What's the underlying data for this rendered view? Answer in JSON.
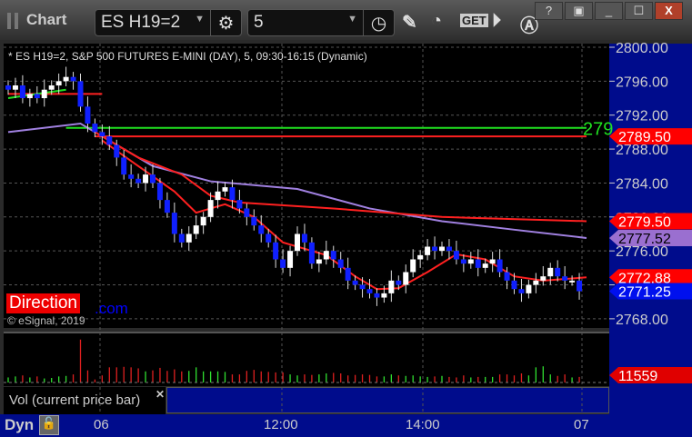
{
  "window": {
    "title": "Chart",
    "help": "?",
    "minimize": "_",
    "close": "X"
  },
  "toolbar": {
    "symbol": "ES H19=2",
    "interval": "5"
  },
  "header": "* ES H19=2, S&P 500 FUTURES E-MINI (DAY), 5, 09:30-16:15 (Dynamic)",
  "watermark": {
    "brand": "Direction",
    "suffix": ".com"
  },
  "copyright": "© eSignal, 2019",
  "price_axis": {
    "ticks": [
      "2800.00",
      "2796.00",
      "2792.00",
      "2788.00",
      "2784.00",
      "2780.00",
      "2776.00",
      "2772.00",
      "2768.00"
    ],
    "tick_values": [
      2800,
      2796,
      2792,
      2788,
      2784,
      2780,
      2776,
      2772,
      2768
    ]
  },
  "markers": [
    {
      "label": "2789.50",
      "value": 2789.5,
      "color": "#ff0000",
      "text": "#ffffff"
    },
    {
      "label": "2779.50",
      "value": 2779.5,
      "color": "#ff0000",
      "text": "#ffffff"
    },
    {
      "label": "2777.52",
      "value": 2777.52,
      "color": "#9a6fd0",
      "text": "#000000"
    },
    {
      "label": "2772.88",
      "value": 2772.88,
      "color": "#ff0000",
      "text": "#ffffff"
    },
    {
      "label": "2771.25",
      "value": 2771.25,
      "color": "#0010ee",
      "text": "#ffffff"
    }
  ],
  "green_level_label": "279",
  "volume": {
    "label": "Vol (current price bar)",
    "close": "✕",
    "last": "11559"
  },
  "time_axis": {
    "dyn": "Dyn",
    "labels": [
      "06",
      "12:00",
      "14:00",
      "07"
    ]
  },
  "chart_data": {
    "type": "candlestick",
    "ylim": [
      2767,
      2800.5
    ],
    "closes": [
      2795,
      2795.5,
      2794,
      2794.5,
      2794,
      2795,
      2795.5,
      2796,
      2796.5,
      2796,
      2793,
      2791,
      2790,
      2789.5,
      2788.5,
      2787,
      2785,
      2784.5,
      2784,
      2785,
      2784,
      2782,
      2780.5,
      2778,
      2777,
      2778,
      2779,
      2780,
      2782,
      2783,
      2783.5,
      2782,
      2781,
      2780,
      2779,
      2778,
      2777,
      2775,
      2774,
      2776,
      2778,
      2777,
      2774.5,
      2775,
      2776,
      2775,
      2774,
      2772.5,
      2772,
      2771.5,
      2771,
      2770.5,
      2771,
      2772.5,
      2772,
      2773.5,
      2775,
      2775.5,
      2776.5,
      2776,
      2776.5,
      2776,
      2775,
      2774.5,
      2775,
      2774,
      2774.5,
      2775,
      2773.5,
      2772.5,
      2771.5,
      2771,
      2772,
      2772.5,
      2773,
      2774,
      2773,
      2772.5,
      2772.5,
      2771.25
    ],
    "volumes": [
      10,
      12,
      14,
      10,
      12,
      8,
      9,
      12,
      13,
      16,
      85,
      24,
      6,
      14,
      30,
      30,
      31,
      30,
      28,
      22,
      24,
      29,
      23,
      26,
      22,
      23,
      30,
      22,
      22,
      22,
      21,
      16,
      16,
      23,
      25,
      22,
      21,
      20,
      20,
      16,
      14,
      16,
      15,
      16,
      18,
      19,
      18,
      14,
      15,
      16,
      15,
      12,
      12,
      16,
      14,
      13,
      14,
      12,
      11,
      12,
      13,
      11,
      10,
      14,
      10,
      11,
      11,
      11,
      16,
      16,
      14,
      18,
      14,
      30,
      32,
      16,
      13,
      16,
      10,
      11
    ],
    "lines": [
      {
        "name": "upper-level",
        "color": "#ff2020",
        "points": [
          [
            0,
            2794.5
          ],
          [
            13,
            2794.5
          ]
        ]
      },
      {
        "name": "green-level",
        "color": "#20e020",
        "points": [
          [
            8,
            2790.5
          ],
          [
            80,
            2790.5
          ]
        ]
      },
      {
        "name": "red-level",
        "color": "#ff2020",
        "points": [
          [
            12,
            2789.5
          ],
          [
            80,
            2789.5
          ]
        ]
      },
      {
        "name": "purple-ma",
        "color": "#a080e0",
        "points": [
          [
            0,
            2790
          ],
          [
            10,
            2791
          ],
          [
            14,
            2789
          ],
          [
            20,
            2786
          ],
          [
            28,
            2784.2
          ],
          [
            40,
            2783.3
          ],
          [
            50,
            2781
          ],
          [
            60,
            2779.5
          ],
          [
            70,
            2778.5
          ],
          [
            80,
            2777.52
          ]
        ]
      },
      {
        "name": "red-ma",
        "color": "#ff2020",
        "points": [
          [
            12,
            2790
          ],
          [
            18,
            2787
          ],
          [
            24,
            2785
          ],
          [
            28,
            2782.5
          ],
          [
            32,
            2781.7
          ],
          [
            45,
            2781
          ],
          [
            60,
            2780
          ],
          [
            80,
            2779.5
          ]
        ]
      },
      {
        "name": "fast-ma",
        "color": "#ff2020",
        "points": [
          [
            13,
            2789
          ],
          [
            18,
            2786
          ],
          [
            23,
            2783
          ],
          [
            26,
            2780.5
          ],
          [
            30,
            2781.5
          ],
          [
            34,
            2780
          ],
          [
            38,
            2777
          ],
          [
            44,
            2775.5
          ],
          [
            48,
            2773
          ],
          [
            51,
            2771.5
          ],
          [
            54,
            2771.6
          ],
          [
            58,
            2773.5
          ],
          [
            62,
            2775.6
          ],
          [
            66,
            2775
          ],
          [
            70,
            2773
          ],
          [
            74,
            2772.5
          ],
          [
            80,
            2772.88
          ]
        ]
      },
      {
        "name": "fast-ma-green",
        "color": "#20e020",
        "points": [
          [
            0,
            2794
          ],
          [
            4,
            2794.5
          ],
          [
            8,
            2795
          ]
        ]
      }
    ]
  }
}
